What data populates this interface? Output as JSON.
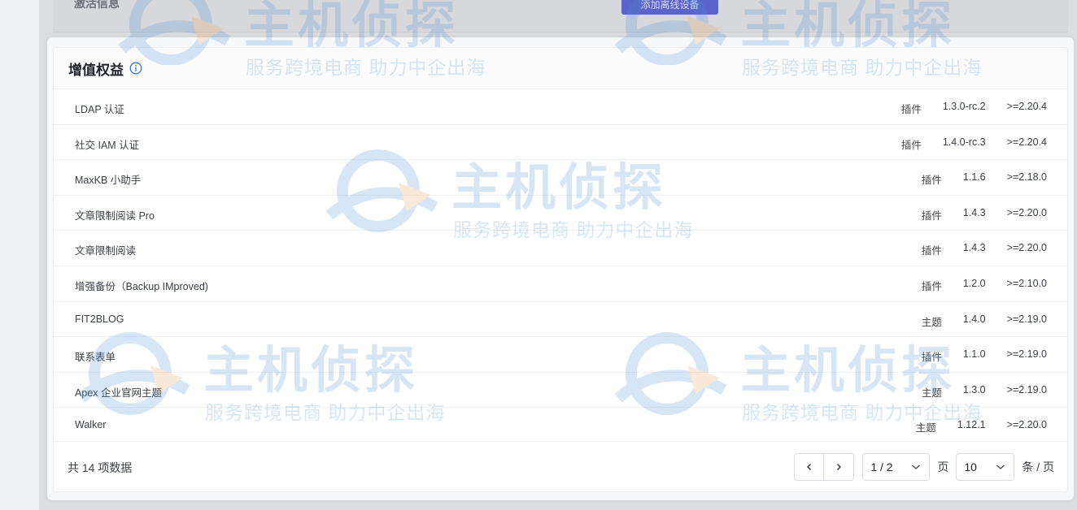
{
  "background": {
    "activate_label": "激活信息",
    "add_offline_device_button": "添加离线设备"
  },
  "panel": {
    "title": "增值权益",
    "info_icon": "info-circle-icon"
  },
  "rows": [
    {
      "name": "LDAP 认证",
      "type": "插件",
      "version": "1.3.0-rc.2",
      "requirement": ">=2.20.4"
    },
    {
      "name": "社交 IAM 认证",
      "type": "插件",
      "version": "1.4.0-rc.3",
      "requirement": ">=2.20.4"
    },
    {
      "name": "MaxKB 小助手",
      "type": "插件",
      "version": "1.1.6",
      "requirement": ">=2.18.0"
    },
    {
      "name": "文章限制阅读 Pro",
      "type": "插件",
      "version": "1.4.3",
      "requirement": ">=2.20.0"
    },
    {
      "name": "文章限制阅读",
      "type": "插件",
      "version": "1.4.3",
      "requirement": ">=2.20.0"
    },
    {
      "name": "增强备份（Backup IMproved)",
      "type": "插件",
      "version": "1.2.0",
      "requirement": ">=2.10.0"
    },
    {
      "name": "FIT2BLOG",
      "type": "主题",
      "version": "1.4.0",
      "requirement": ">=2.19.0"
    },
    {
      "name": "联系表单",
      "type": "插件",
      "version": "1.1.0",
      "requirement": ">=2.19.0"
    },
    {
      "name": "Apex 企业官网主题",
      "type": "主题",
      "version": "1.3.0",
      "requirement": ">=2.19.0"
    },
    {
      "name": "Walker",
      "type": "主题",
      "version": "1.12.1",
      "requirement": ">=2.20.0"
    }
  ],
  "pagination": {
    "total_text": "共 14 项数据",
    "page_select": "1 / 2",
    "page_unit": "页",
    "page_size": "10",
    "size_unit": "条 / 页"
  },
  "watermark": {
    "text": "主机侦探",
    "subtext": "服务跨境电商  助力中企出海"
  }
}
